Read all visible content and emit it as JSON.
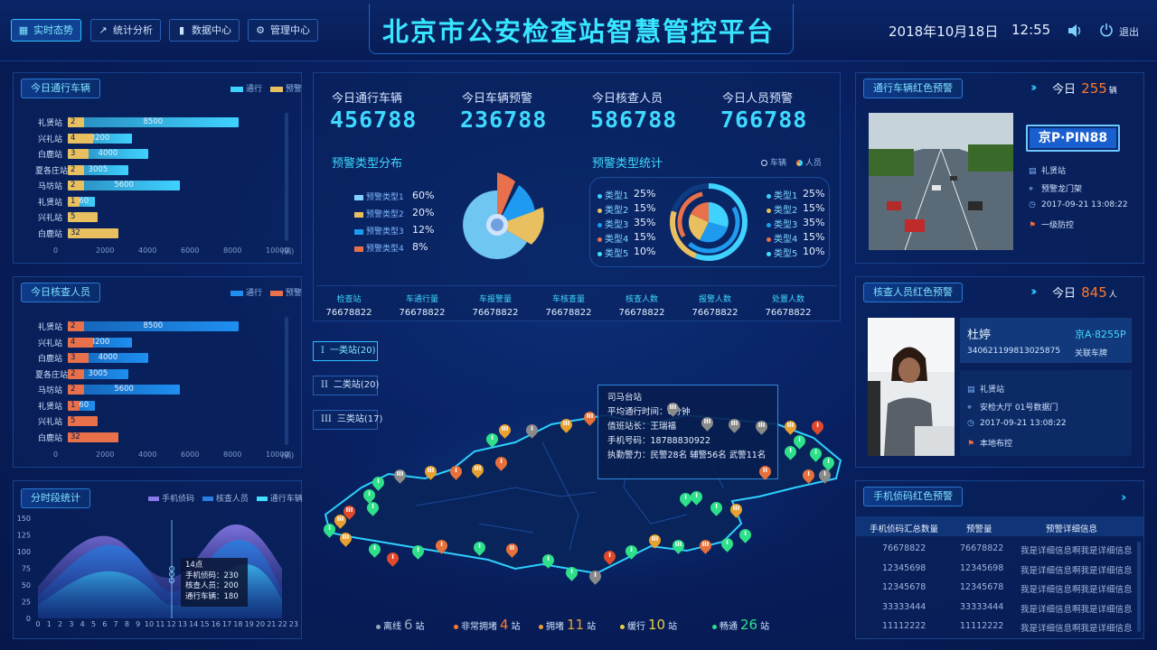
{
  "header": {
    "title": "北京市公安检查站智慧管控平台",
    "nav": [
      {
        "label": "实时态势",
        "icon": "calendar-icon",
        "active": true
      },
      {
        "label": "统计分析",
        "icon": "trend-icon",
        "active": false
      },
      {
        "label": "数据中心",
        "icon": "bar-chart-icon",
        "active": false
      },
      {
        "label": "管理中心",
        "icon": "gear-icon",
        "active": false
      }
    ],
    "date": "2018年10月18日",
    "time": "12:55",
    "logout": "退出"
  },
  "vehicles_panel": {
    "title": "今日通行车辆",
    "legend": [
      "通行",
      "预警"
    ],
    "rows": [
      {
        "station": "礼贤站",
        "warn": 2,
        "pass": 8500
      },
      {
        "station": "兴礼站",
        "warn": 4,
        "pass": 3200
      },
      {
        "station": "白鹿站",
        "warn": 3,
        "pass": 4000
      },
      {
        "station": "夏各庄站",
        "warn": 2,
        "pass": 3005
      },
      {
        "station": "马坊站",
        "warn": 2,
        "pass": 5600
      },
      {
        "station": "礼贤站",
        "warn": 1,
        "pass": 260
      },
      {
        "station": "兴礼站",
        "warn": 5,
        "pass": 100
      },
      {
        "station": "白鹿站",
        "warn": 32,
        "pass": 30
      }
    ],
    "axis": [
      "0",
      "2000",
      "4000",
      "6000",
      "8000",
      "10000"
    ],
    "unit": "(辆)",
    "colors": {
      "pass": "#3fd2ff",
      "warn": "#e8c060"
    }
  },
  "persons_panel": {
    "title": "今日核查人员",
    "legend": [
      "通行",
      "预警"
    ],
    "rows": [
      {
        "station": "礼贤站",
        "warn": 2,
        "pass": 8500
      },
      {
        "station": "兴礼站",
        "warn": 4,
        "pass": 3200
      },
      {
        "station": "白鹿站",
        "warn": 3,
        "pass": 4000
      },
      {
        "station": "夏各庄站",
        "warn": 2,
        "pass": 3005
      },
      {
        "station": "马坊站",
        "warn": 2,
        "pass": 5600
      },
      {
        "station": "礼贤站",
        "warn": 1,
        "pass": 260
      },
      {
        "station": "兴礼站",
        "warn": 5,
        "pass": 100
      },
      {
        "station": "白鹿站",
        "warn": 32,
        "pass": 30
      }
    ],
    "axis": [
      "0",
      "2000",
      "4000",
      "6000",
      "8000",
      "10000"
    ],
    "unit": "(辆)",
    "colors": {
      "pass": "#1e8ff0",
      "warn": "#e8704a"
    }
  },
  "time_panel": {
    "title": "分时段统计",
    "legend": [
      "手机侦码",
      "核查人员",
      "通行车辆"
    ],
    "y_axis": [
      "0",
      "25",
      "50",
      "75",
      "100",
      "125",
      "150"
    ],
    "x_axis": [
      "0",
      "1",
      "2",
      "3",
      "4",
      "5",
      "6",
      "7",
      "8",
      "9",
      "10",
      "11",
      "12",
      "13",
      "14",
      "15",
      "16",
      "17",
      "18",
      "19",
      "20",
      "21",
      "22",
      "23"
    ],
    "tooltip": {
      "title": "14点",
      "phone": "手机侦码：230",
      "persons": "核查人员：200",
      "vehicles": "通行车辆：180"
    },
    "colors": {
      "phone": "#8a7ae8",
      "persons": "#2a7ee0",
      "vehicles": "#3fe0ff"
    }
  },
  "center": {
    "stats": [
      {
        "label": "今日通行车辆",
        "value": "456788"
      },
      {
        "label": "今日车辆预警",
        "value": "236788"
      },
      {
        "label": "今日核查人员",
        "value": "586788"
      },
      {
        "label": "今日人员预警",
        "value": "766788"
      }
    ],
    "dist_title": "预警类型分布",
    "dist": [
      {
        "label": "预警类型1",
        "pct": "60%",
        "color": "#7fd0ff"
      },
      {
        "label": "预警类型2",
        "pct": "20%",
        "color": "#e8c060"
      },
      {
        "label": "预警类型3",
        "pct": "12%",
        "color": "#1e9bf0"
      },
      {
        "label": "预警类型4",
        "pct": "8%",
        "color": "#e8704a"
      }
    ],
    "stat_title": "预警类型统计",
    "stat_legend": [
      "车辆",
      "人员"
    ],
    "types_left": [
      {
        "label": "类型1",
        "pct": "25%"
      },
      {
        "label": "类型2",
        "pct": "15%"
      },
      {
        "label": "类型3",
        "pct": "35%"
      },
      {
        "label": "类型4",
        "pct": "15%"
      },
      {
        "label": "类型5",
        "pct": "10%"
      }
    ],
    "types_right": [
      {
        "label": "类型1",
        "pct": "25%"
      },
      {
        "label": "类型2",
        "pct": "15%"
      },
      {
        "label": "类型3",
        "pct": "35%"
      },
      {
        "label": "类型4",
        "pct": "15%"
      },
      {
        "label": "类型5",
        "pct": "10%"
      }
    ],
    "kpis": [
      {
        "label": "检查站",
        "value": "76678822"
      },
      {
        "label": "车通行量",
        "value": "76678822"
      },
      {
        "label": "车报警量",
        "value": "76678822"
      },
      {
        "label": "车核查量",
        "value": "76678822"
      },
      {
        "label": "核查人数",
        "value": "76678822"
      },
      {
        "label": "报警人数",
        "value": "76678822"
      },
      {
        "label": "处置人数",
        "value": "76678822"
      }
    ],
    "categories": [
      "一类站(20)",
      "二类站(20)",
      "三类站(17)"
    ],
    "category_marks": [
      "I",
      "II",
      "III"
    ],
    "map_tip": {
      "name": "司马台站",
      "avg": "平均通行时间：0分钟",
      "leader": "值班站长：王瑞福",
      "phone": "手机号码：18788830922",
      "force": "执勤警力：民警28名 辅警56名 武警11名"
    },
    "status_bar": [
      {
        "label": "离线",
        "count": "6",
        "unit": "站",
        "color": "#9aa4b8"
      },
      {
        "label": "非常拥堵",
        "count": "4",
        "unit": "站",
        "color": "#ff7a2a"
      },
      {
        "label": "拥堵",
        "count": "11",
        "unit": "站",
        "color": "#e8a030"
      },
      {
        "label": "缓行",
        "count": "10",
        "unit": "站",
        "color": "#e8d040"
      },
      {
        "label": "畅通",
        "count": "26",
        "unit": "站",
        "color": "#2ee08a"
      }
    ]
  },
  "right": {
    "vehicle_alert": {
      "title": "通行车辆红色预警",
      "today": "今日",
      "count": "255",
      "unit": "辆",
      "plate": "京P·PIN88",
      "station": "礼贤站",
      "location": "预警龙门架",
      "time": "2017-09-21  13:08:22",
      "level": "一级防控"
    },
    "person_alert": {
      "title": "核查人员红色预警",
      "today": "今日",
      "count": "845",
      "unit": "人",
      "name": "杜婷",
      "id": "340621199813025875",
      "plate": "京A·8255P",
      "plate_label": "关联车牌",
      "station": "礼贤站",
      "location": "安检大厅 01号数据门",
      "time": "2017-09-21  13:08:22",
      "level": "本地布控"
    },
    "phone_alert": {
      "title": "手机侦码红色预警",
      "headers": [
        "手机侦码汇总数量",
        "预警量",
        "预警详细信息"
      ],
      "rows": [
        [
          "76678822",
          "76678822",
          "我是详细信息啊我是详细信息"
        ],
        [
          "12345698",
          "12345698",
          "我是详细信息啊我是详细信息"
        ],
        [
          "12345678",
          "12345678",
          "我是详细信息啊我是详细信息"
        ],
        [
          "33333444",
          "33333444",
          "我是详细信息啊我是详细信息"
        ],
        [
          "11112222",
          "11112222",
          "我是详细信息啊我是详细信息"
        ]
      ]
    }
  }
}
